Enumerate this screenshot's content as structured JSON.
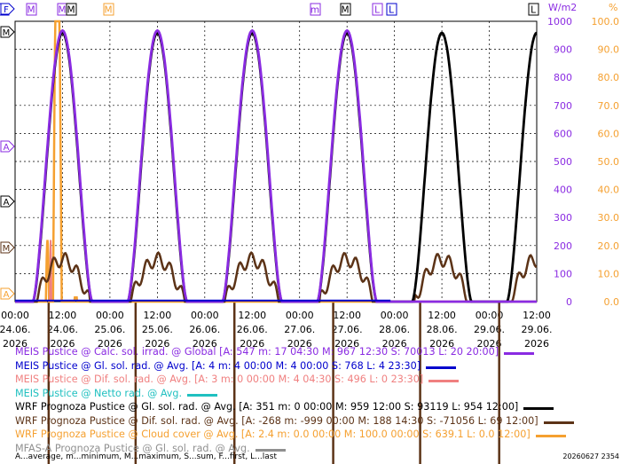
{
  "chart_data": {
    "type": "line",
    "left_axis_label": "W/m2",
    "right_axis_label": "%",
    "left_axis_ticks": [
      "0",
      "100",
      "200",
      "300",
      "400",
      "500",
      "600",
      "700",
      "800",
      "900",
      "1000"
    ],
    "right_axis_ticks": [
      "0.0",
      "10.0",
      "20.0",
      "30.0",
      "40.0",
      "50.0",
      "60.0",
      "70.0",
      "80.0",
      "90.0",
      "100.0"
    ],
    "ylim_left": [
      0,
      1000
    ],
    "ylim_right": [
      0,
      100
    ],
    "x_tick_labels": [
      [
        "00:00",
        "24.06.",
        "2026"
      ],
      [
        "12:00",
        "24.06.",
        "2026"
      ],
      [
        "00:00",
        "25.06.",
        "2026"
      ],
      [
        "12:00",
        "25.06.",
        "2026"
      ],
      [
        "00:00",
        "26.06.",
        "2026"
      ],
      [
        "12:00",
        "26.06.",
        "2026"
      ],
      [
        "00:00",
        "27.06.",
        "2026"
      ],
      [
        "12:00",
        "27.06.",
        "2026"
      ],
      [
        "00:00",
        "28.06.",
        "2026"
      ],
      [
        "12:00",
        "28.06.",
        "2026"
      ],
      [
        "00:00",
        "29.06.",
        "2026"
      ],
      [
        "12:00",
        "29.06.",
        "2026"
      ]
    ],
    "xlim_hours": [
      0,
      132
    ],
    "top_markers": [
      "F",
      "M",
      "M",
      "M",
      "M",
      "m",
      "M",
      "L",
      "L",
      "L"
    ],
    "left_markers": [
      "F",
      "M",
      "A",
      "A",
      "M",
      "A"
    ],
    "series": [
      {
        "name": "MEIS Pustice @ Calc. sol. irrad. @ Global",
        "color": "#8a2be2",
        "days": [
          0,
          1,
          2,
          3
        ],
        "peak": 967
      },
      {
        "name": "WRF Prognoza Pustice @ Gl. sol. rad. @ Avg.",
        "color": "#000000",
        "days": [
          0,
          1,
          2,
          3,
          4,
          5
        ],
        "peak": 959
      },
      {
        "name": "WRF Prognoza Pustice @ Dif. sol. rad. @ Avg.",
        "color": "#5c3317",
        "days": [
          0,
          1,
          2,
          3,
          4,
          5
        ],
        "peak": 188
      },
      {
        "name": "WRF Prognoza Pustice @ Cloud cover @ Avg.",
        "color": "#f5a030",
        "peak": 100
      },
      {
        "name": "MEIS Pustice @ Gl. sol. rad. @ Avg.",
        "color": "#0000cd"
      },
      {
        "name": "MEIS Pustice @ Dif. sol. rad. @ Avg.",
        "color": "#f08080"
      }
    ]
  },
  "legend": [
    {
      "text": "MEIS Pustice @ Calc. sol. irrad. @ Global [A: 547 m: 17 04:30 M: 967 12:30 S: 70013 L: 20 20:00]",
      "color": "#8a2be2",
      "swatch": "#8a2be2"
    },
    {
      "text": "MEIS Pustice @ Gl. sol. rad. @ Avg. [A: 4 m: 4 00:00 M: 4 00:00 S: 768 L: 4 23:30]",
      "color": "#0000cd",
      "swatch": "#0000cd"
    },
    {
      "text": "MEIS Pustice @ Dif. sol. rad. @ Avg. [A: 3 m: 0 00:00 M: 4 04:30 S: 496 L: 0 23:30]",
      "color": "#f08080",
      "swatch": "#f08080"
    },
    {
      "text": "MEIS Pustice @ Netto rad. @ Avg.",
      "color": "#20c0c0",
      "swatch": "#20c0c0"
    },
    {
      "text": "WRF Prognoza Pustice @ Gl. sol. rad. @ Avg. [A: 351 m: 0 00:00 M: 959 12:00 S: 93119 L: 954 12:00]",
      "color": "#000000",
      "swatch": "#000000"
    },
    {
      "text": "WRF Prognoza Pustice @ Dif. sol. rad. @ Avg. [A: -268 m: -999 00:00 M: 188 14:30 S: -71056 L: 69 12:00]",
      "color": "#5c3317",
      "swatch": "#5c3317"
    },
    {
      "text": "WRF Prognoza Pustice @ Cloud cover @ Avg. [A: 2.4 m: 0.0 00:00 M: 100.0 00:00 S: 639.1 L: 0.0 12:00]",
      "color": "#f5a030",
      "swatch": "#f5a030"
    },
    {
      "text": "MFAS-A Prognoza Pustice @ Gl. sol. rad. @ Avg.",
      "color": "#909090",
      "swatch": "#909090"
    }
  ],
  "footer": "A...average, m...minimum, M...maximum, S...sum, F...first, L...last",
  "stamp": "20260627 2354"
}
